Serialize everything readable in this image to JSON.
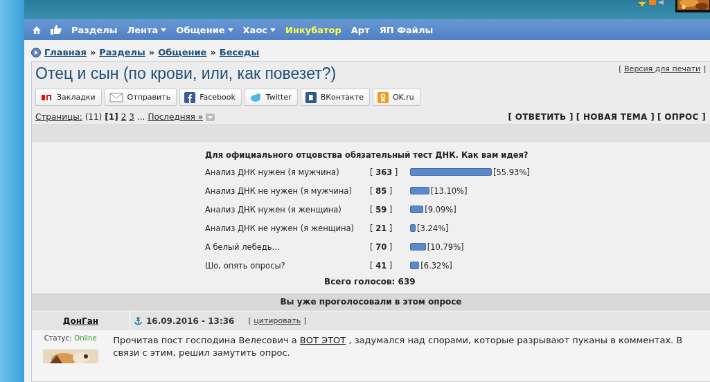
{
  "nav": {
    "items": [
      {
        "label": "Разделы",
        "kind": "plain"
      },
      {
        "label": "Лента",
        "kind": "dropdown"
      },
      {
        "label": "Общение",
        "kind": "dropdown"
      },
      {
        "label": "Хаос",
        "kind": "dropdown"
      },
      {
        "label": "Инкубатор",
        "kind": "highlight"
      },
      {
        "label": "Арт",
        "kind": "plain"
      },
      {
        "label": "ЯП Файлы",
        "kind": "plain"
      }
    ]
  },
  "breadcrumb": [
    "Главная",
    "Разделы",
    "Общение",
    "Беседы"
  ],
  "breadcrumb_separator": "»",
  "topic": {
    "title": "Отец и сын (по крови, или, как повезет?)",
    "print_link": "Версия для печати",
    "brackets": [
      "[",
      "]"
    ]
  },
  "share_buttons": [
    {
      "label": "Закладки",
      "kind": "yap"
    },
    {
      "label": "Отправить",
      "kind": "mail"
    },
    {
      "label": "Facebook",
      "kind": "facebook"
    },
    {
      "label": "Twitter",
      "kind": "twitter"
    },
    {
      "label": "ВКонтакте",
      "kind": "vk"
    },
    {
      "label": "OK.ru",
      "kind": "ok"
    }
  ],
  "pagination": {
    "label": "Страницы:",
    "count": "(11)",
    "pages": [
      {
        "label": "[1]",
        "selected": true
      },
      {
        "label": "2",
        "selected": false
      },
      {
        "label": "3",
        "selected": false
      }
    ],
    "ellipsis": "...",
    "last": "Последняя »"
  },
  "actions": [
    "[ ОТВЕТИТЬ ]",
    "[ НОВАЯ ТЕМА ]",
    "[ ОПРОС ]"
  ],
  "poll": {
    "question": "Для официального отцовства обязательный тест ДНК. Как вам идея?",
    "options": [
      {
        "label": "Анализ ДНК нужен (я мужчина)",
        "votes": "[ **363** ]",
        "percent": "[55.93%]"
      },
      {
        "label": "Анализ ДНК не нужен (я мужчина)",
        "votes": "[ **85** ]",
        "percent": "[13.10%]"
      },
      {
        "label": "Анализ ДНК нужен (я женщина)",
        "votes": "[ **59** ]",
        "percent": "[9.09%]"
      },
      {
        "label": "Анализ ДНК не нужен (я женщина)",
        "votes": "[ **21** ]",
        "percent": "[3.24%]"
      },
      {
        "label": "А белый лебедь...",
        "votes": "[ **70** ]",
        "percent": "[10.79%]"
      },
      {
        "label": "Шо, опять опросы?",
        "votes": "[ **41** ]",
        "percent": "[6.32%]"
      }
    ],
    "total": "Всего голосов: 639",
    "footer": "Вы уже проголосовали в этом опросе"
  },
  "post": {
    "author": "ДонГан",
    "date": "16.09.2016 - 13:36",
    "quote": "цитировать",
    "quote_brackets": [
      "[",
      "]"
    ],
    "status_label": "Статус:",
    "status": "Online",
    "text_before": "Прочитав пост господина Велесович а",
    "link": "ВОТ ЭТОТ",
    "text_after": ", задумался над спорами, которые разрывают пуканы в комментах. В связи с этим, решил замутить опрос."
  }
}
